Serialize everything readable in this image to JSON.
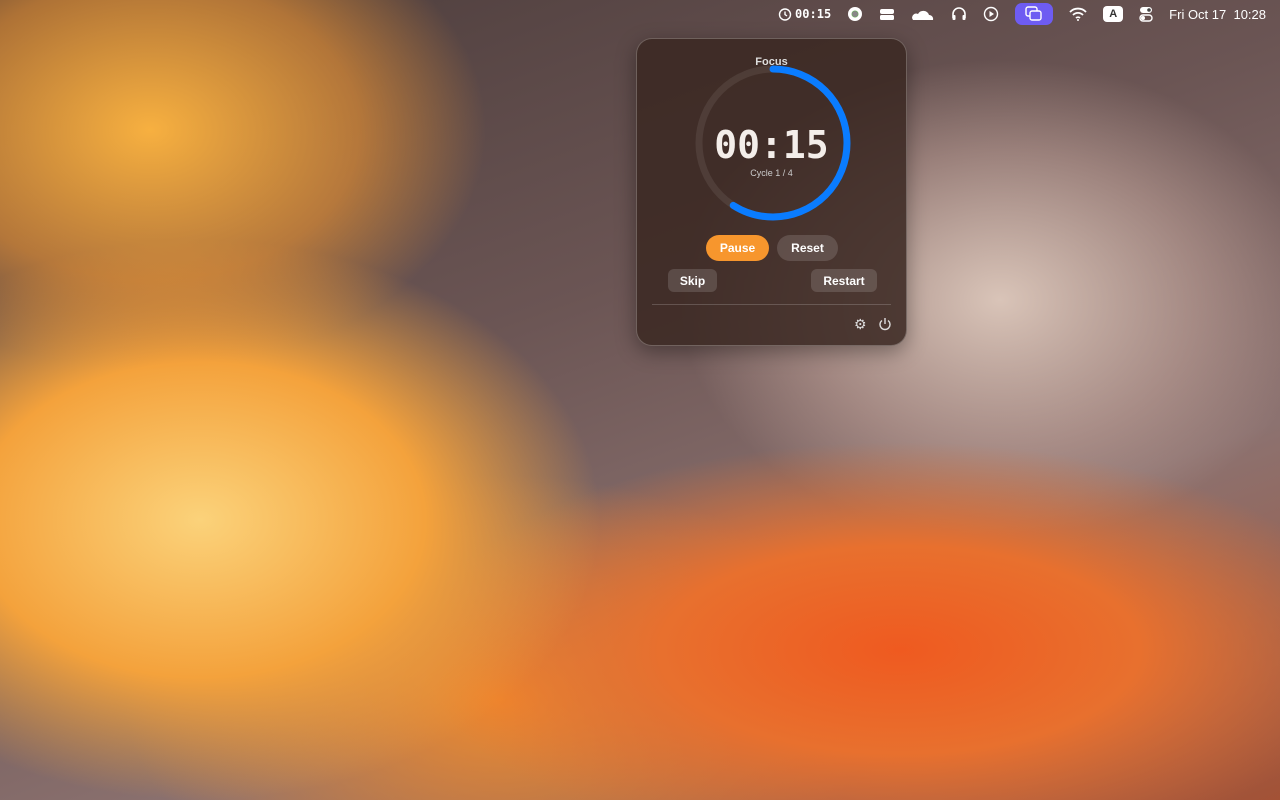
{
  "menubar": {
    "timer": "00:15",
    "clock": "Fri Oct 17  10:28",
    "icons": [
      "timer-icon",
      "record-icon",
      "drive-icon",
      "cloud-icon",
      "headphones-icon",
      "play-icon",
      "screens-icon",
      "wifi-icon",
      "input-source-icon",
      "control-center-icon"
    ],
    "input_key": "A",
    "active_color": "#6e5cf2"
  },
  "popover": {
    "title": "Focus",
    "time": "00:15",
    "cycle": "Cycle 1 / 4",
    "progress": 0.59,
    "progress_color": "#0a7cff",
    "buttons": {
      "pause": "Pause",
      "reset": "Reset",
      "skip": "Skip",
      "restart": "Restart"
    },
    "pause_color": "#f7962d"
  }
}
